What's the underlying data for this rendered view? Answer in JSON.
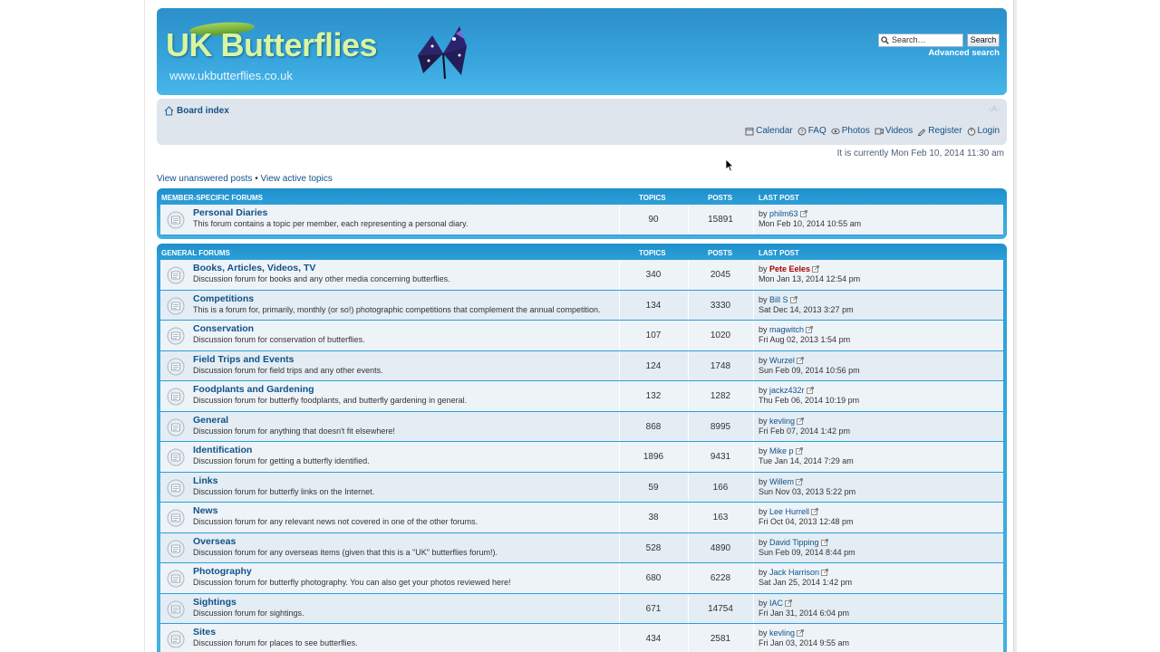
{
  "header": {
    "site_title": "UK Butterflies",
    "site_url": "www.ukbutterflies.co.uk",
    "search_placeholder": "Search…",
    "search_button": "Search",
    "advanced_search": "Advanced search",
    "accent_color": "#36a3dc"
  },
  "navbar": {
    "board_index": "Board index",
    "font_size": "A",
    "links": [
      {
        "label": "Calendar",
        "icon": "calendar-icon"
      },
      {
        "label": "FAQ",
        "icon": "faq-icon"
      },
      {
        "label": "Photos",
        "icon": "photos-icon"
      },
      {
        "label": "Videos",
        "icon": "videos-icon"
      },
      {
        "label": "Register",
        "icon": "register-icon"
      },
      {
        "label": "Login",
        "icon": "login-icon"
      }
    ]
  },
  "datetime": "It is currently Mon Feb 10, 2014 11:30 am",
  "search_links": {
    "unanswered": "View unanswered posts",
    "separator": "•",
    "active": "View active topics"
  },
  "columns": {
    "topics": "TOPICS",
    "posts": "POSTS",
    "last_post": "LAST POST"
  },
  "categories": [
    {
      "title": "MEMBER-SPECIFIC FORUMS",
      "forums": [
        {
          "name": "Personal Diaries",
          "desc": "This forum contains a topic per member, each representing a personal diary.",
          "topics": "90",
          "posts": "15891",
          "by": "by",
          "user": "philm63",
          "user_red": false,
          "date": "Mon Feb 10, 2014 10:55 am"
        }
      ]
    },
    {
      "title": "GENERAL FORUMS",
      "forums": [
        {
          "name": "Books, Articles, Videos, TV",
          "desc": "Discussion forum for books and any other media concerning butterflies.",
          "topics": "340",
          "posts": "2045",
          "by": "by",
          "user": "Pete Eeles",
          "user_red": true,
          "date": "Mon Jan 13, 2014 12:54 pm"
        },
        {
          "name": "Competitions",
          "desc": "This is a forum for, primarily, monthly (or so!) photographic competitions that complement the annual competition.",
          "topics": "134",
          "posts": "3330",
          "by": "by",
          "user": "Bill S",
          "user_red": false,
          "date": "Sat Dec 14, 2013 3:27 pm"
        },
        {
          "name": "Conservation",
          "desc": "Discussion forum for conservation of butterflies.",
          "topics": "107",
          "posts": "1020",
          "by": "by",
          "user": "magwitch",
          "user_red": false,
          "date": "Fri Aug 02, 2013 1:54 pm"
        },
        {
          "name": "Field Trips and Events",
          "desc": "Discussion forum for field trips and any other events.",
          "topics": "124",
          "posts": "1748",
          "by": "by",
          "user": "Wurzel",
          "user_red": false,
          "date": "Sun Feb 09, 2014 10:56 pm"
        },
        {
          "name": "Foodplants and Gardening",
          "desc": "Discussion forum for butterfly foodplants, and butterfly gardening in general.",
          "topics": "132",
          "posts": "1282",
          "by": "by",
          "user": "jackz432r",
          "user_red": false,
          "date": "Thu Feb 06, 2014 10:19 pm"
        },
        {
          "name": "General",
          "desc": "Discussion forum for anything that doesn't fit elsewhere!",
          "topics": "868",
          "posts": "8995",
          "by": "by",
          "user": "kevling",
          "user_red": false,
          "date": "Fri Feb 07, 2014 1:42 pm"
        },
        {
          "name": "Identification",
          "desc": "Discussion forum for getting a butterfly identified.",
          "topics": "1896",
          "posts": "9431",
          "by": "by",
          "user": "Mike p",
          "user_red": false,
          "date": "Tue Jan 14, 2014 7:29 am"
        },
        {
          "name": "Links",
          "desc": "Discussion forum for butterfly links on the Internet.",
          "topics": "59",
          "posts": "166",
          "by": "by",
          "user": "Willem",
          "user_red": false,
          "date": "Sun Nov 03, 2013 5:22 pm"
        },
        {
          "name": "News",
          "desc": "Discussion forum for any relevant news not covered in one of the other forums.",
          "topics": "38",
          "posts": "163",
          "by": "by",
          "user": "Lee Hurrell",
          "user_red": false,
          "date": "Fri Oct 04, 2013 12:48 pm"
        },
        {
          "name": "Overseas",
          "desc": "Discussion forum for any overseas items (given that this is a \"UK\" butterflies forum!).",
          "topics": "528",
          "posts": "4890",
          "by": "by",
          "user": "David Tipping",
          "user_red": false,
          "date": "Sun Feb 09, 2014 8:44 pm"
        },
        {
          "name": "Photography",
          "desc": "Discussion forum for butterfly photography. You can also get your photos reviewed here!",
          "topics": "680",
          "posts": "6228",
          "by": "by",
          "user": "Jack Harrison",
          "user_red": false,
          "date": "Sat Jan 25, 2014 1:42 pm"
        },
        {
          "name": "Sightings",
          "desc": "Discussion forum for sightings.",
          "topics": "671",
          "posts": "14754",
          "by": "by",
          "user": "IAC",
          "user_red": false,
          "date": "Fri Jan 31, 2014 6:04 pm"
        },
        {
          "name": "Sites",
          "desc": "Discussion forum for places to see butterflies.",
          "topics": "434",
          "posts": "2581",
          "by": "by",
          "user": "kevling",
          "user_red": false,
          "date": "Fri Jan 03, 2014 9:55 am"
        }
      ]
    }
  ]
}
